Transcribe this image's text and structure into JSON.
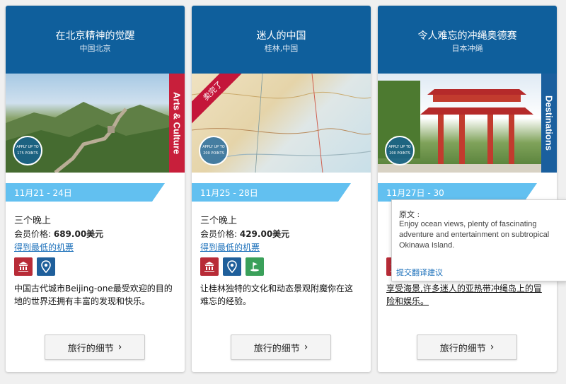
{
  "cards": [
    {
      "title": "在北京精神的觉醒",
      "subtitle": "中国北京",
      "side_tag": "Arts & Culture",
      "stamp": "APPLY UP TO 175 POINTS",
      "dates": "11月21 - 24日",
      "nights": "三个晚上",
      "price_label": "会员价格: ",
      "price_value": "689.00美元",
      "flight_link": "得到最低的机票",
      "icons": [
        "museum-icon",
        "location-pin-icon"
      ],
      "description": "中国古代城市Beijing-one最受欢迎的目的地的世界还拥有丰富的发现和快乐。",
      "detail_button": "旅行的细节"
    },
    {
      "title": "迷人的中国",
      "subtitle": "桂林,中国",
      "ribbon": "卖完了",
      "stamp": "APPLY UP TO 200 POINTS",
      "dates": "11月25 - 28日",
      "nights": "三个晚上",
      "price_label": "会员价格: ",
      "price_value": "429.00美元",
      "flight_link": "得到最低的机票",
      "icons": [
        "museum-icon",
        "location-pin-icon",
        "golf-icon"
      ],
      "description": "让桂林独特的文化和动态景观附魔你在这难忘的经验。",
      "detail_button": "旅行的细节"
    },
    {
      "title": "令人难忘的冲绳奥德赛",
      "subtitle": "日本冲绳",
      "side_tag": "Destinations",
      "stamp": "APPLY UP TO 200 POINTS",
      "dates": "11月27日 - 30",
      "icons": [
        "museum-icon"
      ],
      "description": "享受海景,许多迷人的亚热带冲绳岛上的冒险和娱乐。",
      "detail_button": "旅行的细节"
    }
  ],
  "tooltip": {
    "label": "原文 :",
    "text": "Enjoy ocean views, plenty of fascinating adventure and entertainment on subtropical Okinawa Island.",
    "suggest": "提交翻译建议"
  }
}
